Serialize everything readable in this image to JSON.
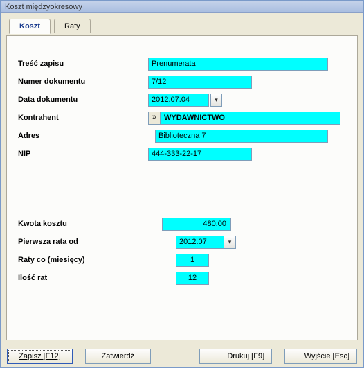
{
  "window": {
    "title": "Koszt międzyokresowy"
  },
  "tabs": {
    "koszt": "Koszt",
    "raty": "Raty"
  },
  "labels": {
    "tresc": "Treść zapisu",
    "numer": "Numer dokumentu",
    "data_dok": "Data dokumentu",
    "kontrahent": "Kontrahent",
    "adres": "Adres",
    "nip": "NIP",
    "kwota": "Kwota kosztu",
    "pierwsza": "Pierwsza rata od",
    "raty_co": "Raty co (miesięcy)",
    "ilosc_rat": "Ilość rat"
  },
  "values": {
    "tresc": "Prenumerata",
    "numer": "7/12",
    "data_dok": "2012.07.04",
    "kontrahent": "WYDAWNICTWO",
    "adres": "Biblioteczna 7",
    "nip": "444-333-22-17",
    "kwota": "480.00",
    "pierwsza": "2012.07",
    "raty_co": "1",
    "ilosc_rat": "12"
  },
  "buttons": {
    "pick": "»",
    "zapisz": "Zapisz  [F12]",
    "zatwierdz": "Zatwierdź",
    "drukuj": "Drukuj  [F9]",
    "wyjscie": "Wyjście [Esc]"
  },
  "icons": {
    "dropdown": "▾"
  }
}
